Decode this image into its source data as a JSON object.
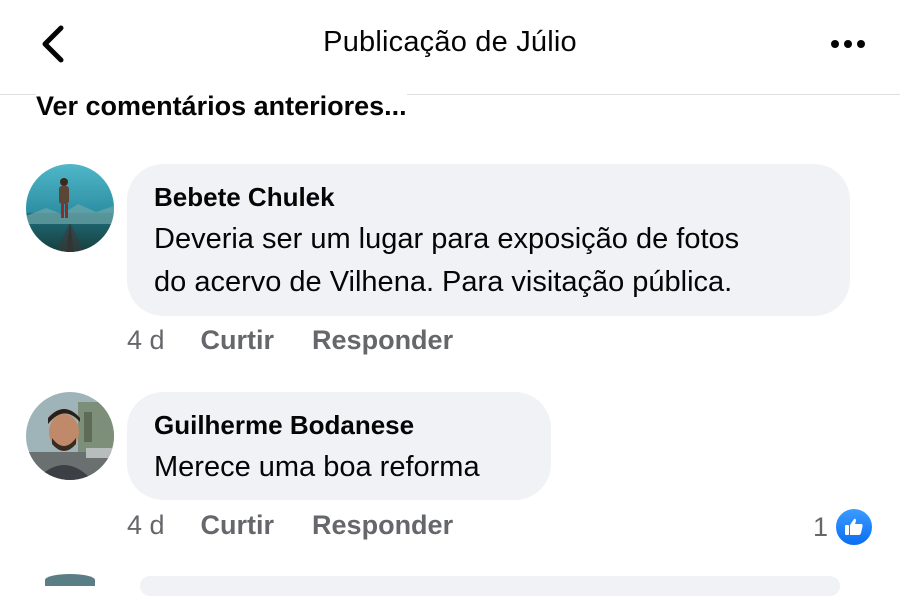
{
  "header": {
    "title": "Publicação de Júlio",
    "back_icon": "chevron-left-icon",
    "more_icon": "more-horizontal-icon"
  },
  "previous_comments_label": "Ver comentários anteriores...",
  "comments": [
    {
      "author": "Bebete Chulek",
      "text_lines": [
        "Deveria ser um lugar para exposição de fotos",
        "do acervo de Vilhena. Para visitação pública."
      ],
      "time": "4 d",
      "like_label": "Curtir",
      "reply_label": "Responder",
      "reaction_count": null
    },
    {
      "author": "Guilherme Bodanese",
      "text_lines": [
        "Merece uma boa reforma"
      ],
      "time": "4 d",
      "like_label": "Curtir",
      "reply_label": "Responder",
      "reaction_count": "1",
      "reaction_icon": "thumbs-up-icon"
    }
  ],
  "colors": {
    "bubble_bg": "#f0f2f5",
    "secondary_text": "#65676b",
    "like_blue": "#0a6ff2"
  }
}
